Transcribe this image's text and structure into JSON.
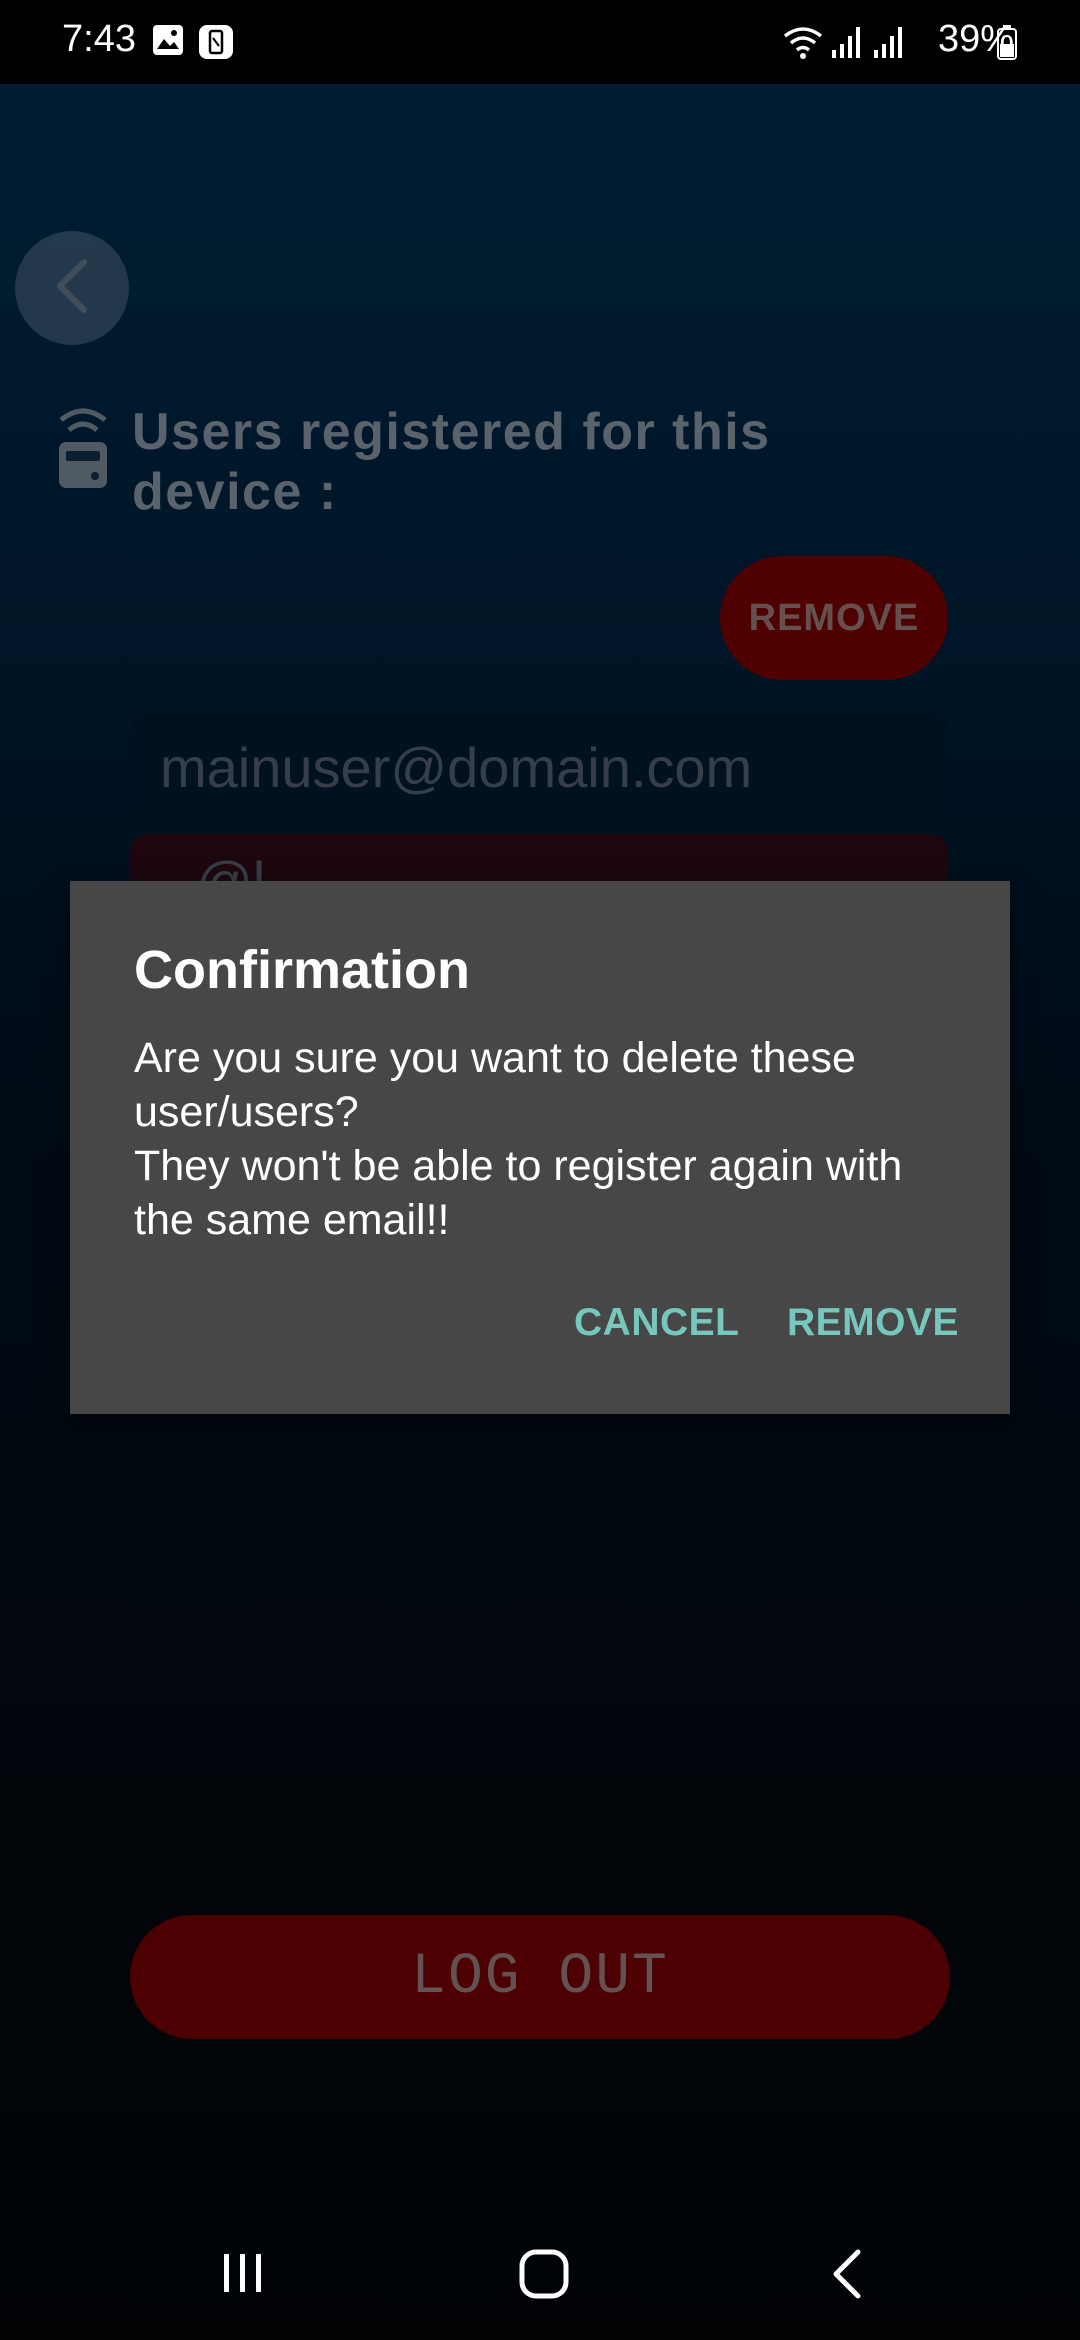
{
  "status_bar": {
    "time": "7:43",
    "battery_percent": "39%",
    "icons": [
      "gallery-icon",
      "screenshot-icon",
      "wifi-icon",
      "signal-icon",
      "signal-icon",
      "battery-icon"
    ]
  },
  "screen": {
    "back_icon": "chevron-left-icon",
    "section_icon": "wireless-device-icon",
    "section_title": "Users registered for this device :",
    "remove_button_label": "REMOVE",
    "users": [
      "mainuser@domain.com",
      "@l"
    ],
    "logout_label": "LOG OUT"
  },
  "dialog": {
    "title": "Confirmation",
    "message": "Are you sure you want to delete these user/users?\nThey won't be able to register again with the same email!!",
    "cancel_label": "CANCEL",
    "confirm_label": "REMOVE"
  },
  "navigation_bar": {
    "icons": [
      "recent-apps-icon",
      "home-icon",
      "back-icon"
    ]
  },
  "colors": {
    "accent": "#76c7bd",
    "danger": "#6e0002",
    "dialog_bg": "#474747"
  }
}
